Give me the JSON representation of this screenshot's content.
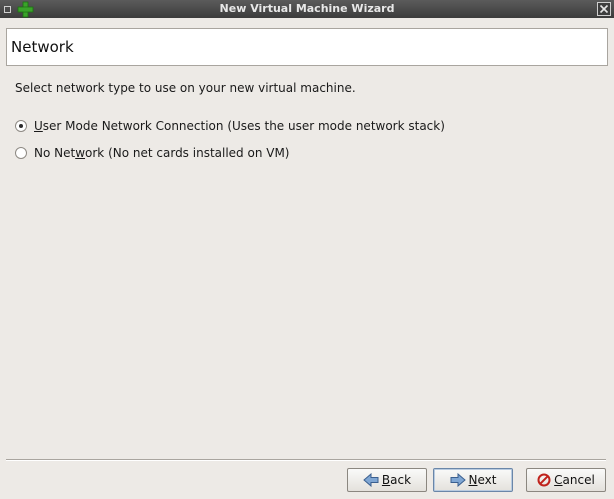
{
  "window": {
    "title": "New Virtual Machine Wizard"
  },
  "icons": {
    "window_menu": "window-menu-icon",
    "app": "green-plus-icon",
    "close": "close-icon",
    "back": "back-arrow-icon",
    "next": "next-arrow-icon",
    "cancel": "cancel-icon"
  },
  "header": {
    "title": "Network"
  },
  "body": {
    "instructions": "Select network type to use on your new virtual machine.",
    "options": [
      {
        "accel": "U",
        "label_rest": "ser Mode Network Connection (Uses the user mode network stack)",
        "selected": true
      },
      {
        "label_pre": "No Net",
        "accel": "w",
        "label_post": "ork (No net cards installed on VM)",
        "selected": false
      }
    ]
  },
  "buttons": {
    "back": {
      "accel": "B",
      "rest": "ack"
    },
    "next": {
      "accel": "N",
      "rest": "ext"
    },
    "cancel": {
      "accel": "C",
      "rest": "ancel"
    }
  },
  "colors": {
    "background": "#edeae6",
    "titlebar": "#3c3c3c",
    "accent_green": "#3aa32a"
  }
}
